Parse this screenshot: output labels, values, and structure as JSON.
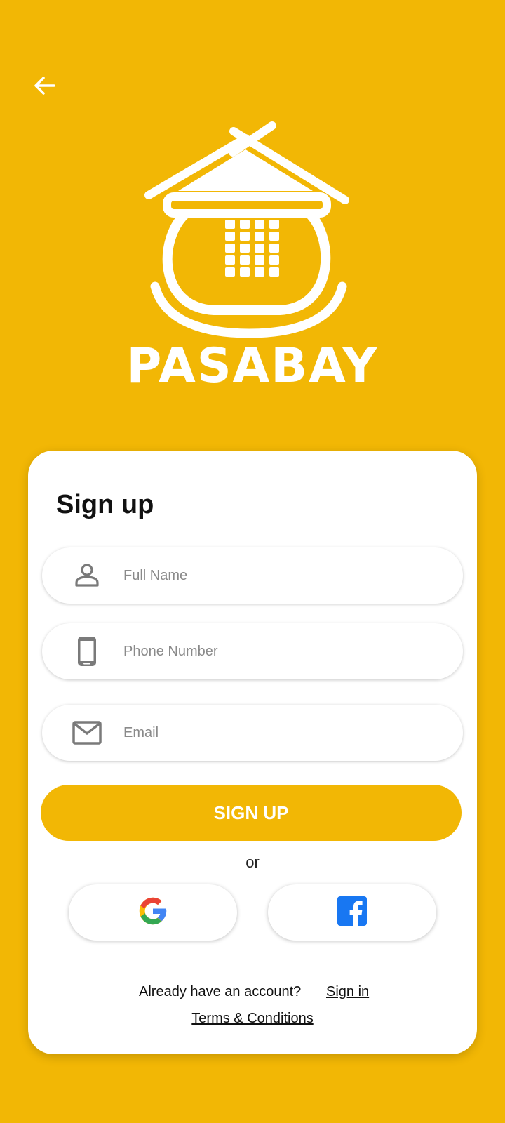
{
  "colors": {
    "primary": "#F2B705",
    "card_background": "#FFFFFF",
    "text": "#111111",
    "icon_gray": "#7A7A7A",
    "placeholder": "#8A8A8A",
    "facebook_blue": "#1877F2",
    "google_blue": "#4285F4",
    "google_red": "#EA4335",
    "google_yellow": "#FBBC05",
    "google_green": "#34A853"
  },
  "header": {
    "back_icon": "arrow-left-icon"
  },
  "brand": {
    "logo_icon": "pot-house-logo-icon",
    "name": "PASABAY"
  },
  "signup": {
    "title": "Sign up",
    "fields": [
      {
        "icon": "person-icon",
        "placeholder": "Full Name",
        "value": ""
      },
      {
        "icon": "smartphone-icon",
        "placeholder": "Phone Number",
        "value": ""
      },
      {
        "icon": "envelope-icon",
        "placeholder": "Email",
        "value": ""
      }
    ],
    "submit_label": "SIGN UP",
    "or_text": "or",
    "social": [
      {
        "provider": "Google",
        "icon": "google-icon"
      },
      {
        "provider": "Facebook",
        "icon": "facebook-icon"
      }
    ]
  },
  "footer": {
    "account_prompt": "Already have an account?",
    "signin_link": "Sign in",
    "terms_link": "Terms & Conditions"
  }
}
